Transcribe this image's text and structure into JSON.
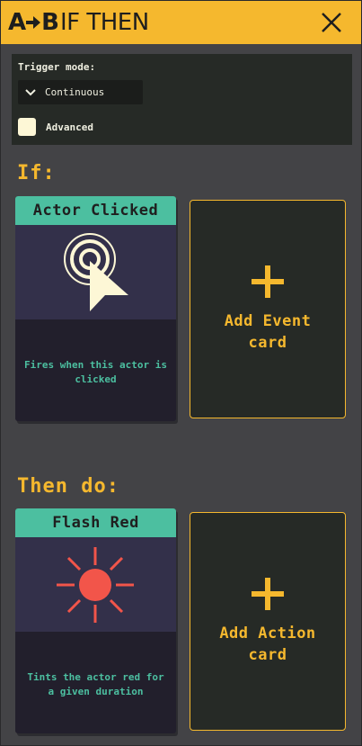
{
  "titlebar": {
    "logo_a": "A",
    "logo_b": "B",
    "title": "IF THEN"
  },
  "settings": {
    "trigger_label": "Trigger mode:",
    "trigger_value": "Continuous",
    "advanced_label": "Advanced",
    "advanced_checked": false
  },
  "if_section": {
    "label": "If:",
    "card": {
      "title": "Actor Clicked",
      "icon": "click-cursor-icon",
      "desc": "Fires when this actor is clicked"
    },
    "add_label": "Add Event\ncard"
  },
  "then_section": {
    "label": "Then do:",
    "card": {
      "title": "Flash Red",
      "icon": "sun-flash-icon",
      "desc": "Tints the actor red for a given duration"
    },
    "add_label": "Add Action\ncard"
  },
  "colors": {
    "accent": "#f5b82e",
    "card_header": "#4cbfa0",
    "card_art_bg": "#33304a",
    "flash_red": "#f2554a",
    "cream": "#fdf7d6"
  }
}
